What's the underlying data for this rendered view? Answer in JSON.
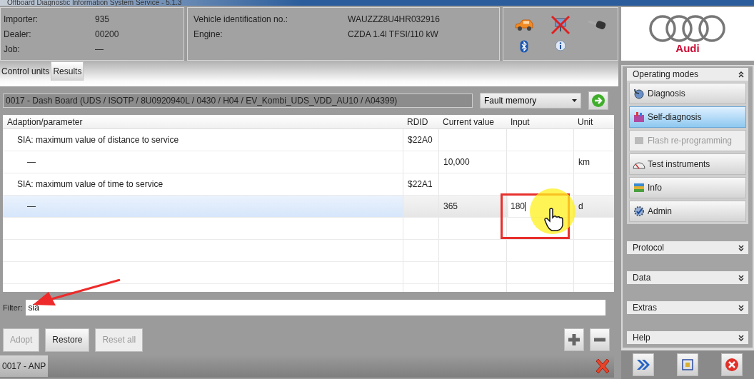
{
  "window": {
    "title": "Offboard Diagnostic Information System Service - 5.1.3"
  },
  "header": {
    "dealer_info": [
      {
        "label": "Importer:",
        "value": "935"
      },
      {
        "label": "Dealer:",
        "value": "00200"
      },
      {
        "label": "Job:",
        "value": "—"
      }
    ],
    "vehicle_info": [
      {
        "label": "Vehicle identification no.:",
        "value": "WAUZZZ8U4HR032916"
      },
      {
        "label": "Engine:",
        "value": "CZDA 1.4l TFSI/110 kW"
      }
    ],
    "logo_text": "Audi"
  },
  "tabs": [
    {
      "label": "Control units",
      "selected": false
    },
    {
      "label": "Results",
      "selected": true
    }
  ],
  "ecu": {
    "description": "0017 - Dash Board  (UDS / ISOTP / 8U0920940L / 0430 / H04 / EV_Kombi_UDS_VDD_AU10 / A04399)",
    "mode": "Fault memory"
  },
  "table": {
    "columns": [
      "Adaption/parameter",
      "RDID",
      "Current value",
      "Input",
      "Unit"
    ],
    "rows": [
      {
        "parameter": "SIA: maximum value of distance to service",
        "rdid": "$22A0",
        "children": [
          {
            "parameter": "—",
            "current_value": "10,000",
            "unit": "km",
            "selected": false
          }
        ]
      },
      {
        "parameter": "SIA: maximum value of time to service",
        "rdid": "$22A1",
        "children": [
          {
            "parameter": "—",
            "current_value": "365",
            "input": "180",
            "unit": "d",
            "selected": true
          }
        ]
      }
    ]
  },
  "filter": {
    "label": "Filter:",
    "value": "sia"
  },
  "buttons": [
    {
      "label": "Adopt",
      "disabled": true
    },
    {
      "label": "Restore",
      "disabled": false
    },
    {
      "label": "Reset all",
      "disabled": true
    }
  ],
  "status_tab": "0017 - ANP",
  "sidebar": {
    "operating_modes": {
      "title": "Operating modes",
      "expanded": true,
      "items": [
        {
          "label": "Diagnosis",
          "kind": "diagnosis",
          "selected": false,
          "disabled": false
        },
        {
          "label": "Self-diagnosis",
          "kind": "self",
          "selected": true,
          "disabled": false
        },
        {
          "label": "Flash re-programming",
          "kind": "flash",
          "selected": false,
          "disabled": true
        },
        {
          "label": "Test instruments",
          "kind": "gauge",
          "selected": false,
          "disabled": false
        },
        {
          "label": "Info",
          "kind": "info",
          "selected": false,
          "disabled": false
        },
        {
          "label": "Admin",
          "kind": "admin",
          "selected": false,
          "disabled": false
        }
      ]
    },
    "sections": [
      {
        "title": "Protocol",
        "expanded": false
      },
      {
        "title": "Data",
        "expanded": false
      },
      {
        "title": "Extras",
        "expanded": false
      },
      {
        "title": "Help",
        "expanded": false
      }
    ]
  }
}
